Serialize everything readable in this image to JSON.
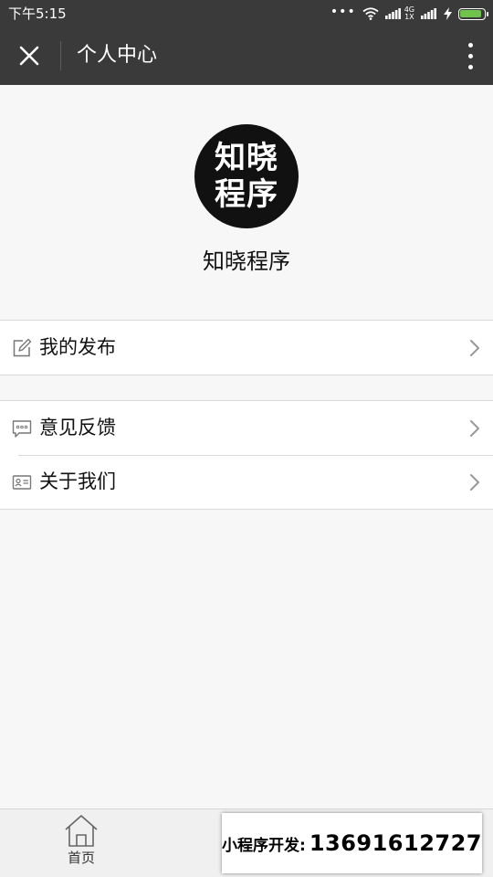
{
  "status_bar": {
    "time": "下午5:15",
    "network_top": "4G",
    "network_bottom": "1X",
    "battery_level": 0.9,
    "icons": [
      "more-dots-icon",
      "wifi-icon",
      "signal-icon",
      "signal-icon",
      "charging-icon",
      "battery-icon"
    ]
  },
  "nav": {
    "title": "个人中心",
    "close_icon": "close-icon",
    "more_icon": "more-vertical-icon"
  },
  "profile": {
    "avatar_line1": "知晓",
    "avatar_line2": "程序",
    "name": "知晓程序"
  },
  "menu": {
    "group1": [
      {
        "label": "我的发布",
        "icon": "edit-icon"
      }
    ],
    "group2": [
      {
        "label": "意见反馈",
        "icon": "feedback-icon"
      },
      {
        "label": "关于我们",
        "icon": "id-card-icon"
      }
    ]
  },
  "tab_bar": {
    "home_label": "首页",
    "home_icon": "home-icon"
  },
  "promo": {
    "label": "小程序开发:",
    "phone": "13691612727"
  },
  "colors": {
    "bar_bg": "#3a3a3a",
    "page_bg": "#f7f7f7",
    "battery_fill": "#6fc24b",
    "divider": "#d9d9d9"
  }
}
